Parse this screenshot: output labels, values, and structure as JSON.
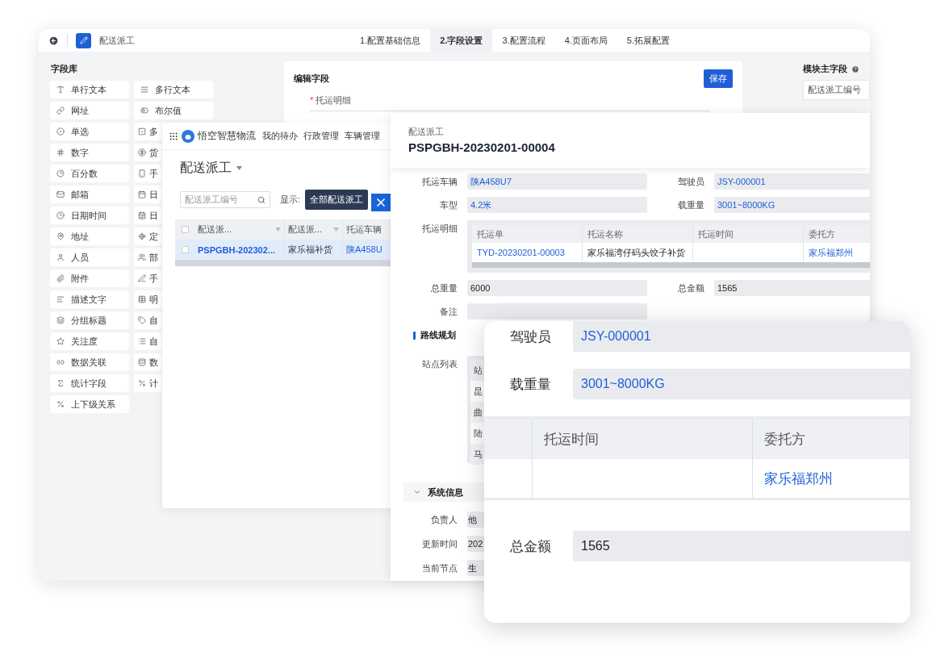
{
  "config_window": {
    "title": "配送派工",
    "steps": [
      {
        "label": "1.配置基础信息",
        "selected": false
      },
      {
        "label": "2.字段设置",
        "selected": true
      },
      {
        "label": "3.配置流程",
        "selected": false
      },
      {
        "label": "4.页面布局",
        "selected": false
      },
      {
        "label": "5.拓展配置",
        "selected": false
      }
    ],
    "field_library": {
      "title": "字段库",
      "left": [
        "单行文本",
        "网址",
        "单选",
        "数字",
        "百分数",
        "邮箱",
        "日期时间",
        "地址",
        "人员",
        "附件",
        "描述文字",
        "分组标题",
        "关注度",
        "数据关联",
        "统计字段",
        "上下级关系"
      ],
      "right": [
        "多行文本",
        "布尔值",
        "多",
        "货",
        "手",
        "日",
        "日",
        "定",
        "部",
        "手",
        "明",
        "自",
        "自",
        "数",
        "计"
      ]
    },
    "editor": {
      "title": "编辑字段",
      "save": "保存",
      "required_mark": "*",
      "field_label": "托运明细"
    },
    "main_field": {
      "title": "模块主字段",
      "value": "配送派工编号"
    }
  },
  "list_window": {
    "app_name": "悟空智慧物流",
    "nav": [
      "我的待办",
      "行政管理",
      "车辆管理"
    ],
    "title": "配送派工",
    "search_placeholder": "配送派工编号",
    "filter_label": "显示:",
    "filters": [
      {
        "label": "全部配送派工",
        "selected": true
      }
    ],
    "all_checked": false,
    "columns": [
      "配送派...",
      "配送派...",
      "托运车辆"
    ],
    "rows": [
      {
        "selected": true,
        "checked": false,
        "cells": [
          "PSPGBH-202302...",
          "家乐福补货",
          "陕A458U"
        ]
      }
    ]
  },
  "detail_window": {
    "module": "配送派工",
    "code": "PSPGBH-20230201-00004",
    "form": [
      {
        "kind": "pair",
        "fields": [
          {
            "label": "托运车辆",
            "value": "陕A458U7",
            "link": true
          },
          {
            "label": "驾驶员",
            "value": "JSY-000001",
            "link": true
          }
        ]
      },
      {
        "kind": "pair",
        "fields": [
          {
            "label": "车型",
            "value": "4.2米",
            "link": true
          },
          {
            "label": "载重量",
            "value": "3001~8000KG",
            "link": true
          }
        ]
      },
      {
        "kind": "table",
        "label": "托运明细",
        "columns": [
          "托运单",
          "托运名称",
          "托运时间",
          "委托方"
        ],
        "rows": [
          [
            {
              "text": "TYD-20230201-00003",
              "link": true
            },
            {
              "text": "家乐福湾仔码头饺子补货",
              "link": false
            },
            {},
            {
              "text": "家乐福郑州",
              "link": true
            }
          ]
        ]
      },
      {
        "kind": "pair",
        "fields": [
          {
            "label": "总重量",
            "value": "6000",
            "link": false
          },
          {
            "label": "总金额",
            "value": "1565",
            "link": false
          }
        ]
      },
      {
        "kind": "pair",
        "fields": [
          {
            "label": "备注"
          }
        ]
      }
    ],
    "route": {
      "title": "路线规划",
      "label": "站点列表",
      "header": "站",
      "stations": [
        "昆",
        "曲",
        "陆",
        "马"
      ]
    },
    "system": {
      "title": "系统信息",
      "expanded": true,
      "fields": [
        {
          "label": "负责人",
          "value": "他"
        },
        {
          "label": "更新时间",
          "value": "202"
        },
        {
          "label": "当前节点",
          "value": "生"
        }
      ]
    }
  },
  "zoom_card": {
    "fields": [
      {
        "label": "驾驶员",
        "value": "JSY-000001",
        "link": true
      },
      {
        "label": "载重量",
        "value": "3001~8000KG",
        "link": true
      }
    ],
    "columns": [
      {},
      {
        "label": "托运时间"
      },
      {
        "label": "委托方"
      }
    ],
    "rows": [
      [
        {},
        {},
        {
          "text": "家乐福郑州",
          "link": true
        }
      ]
    ],
    "total": {
      "label": "总金额",
      "value": "1565",
      "link": false
    }
  }
}
